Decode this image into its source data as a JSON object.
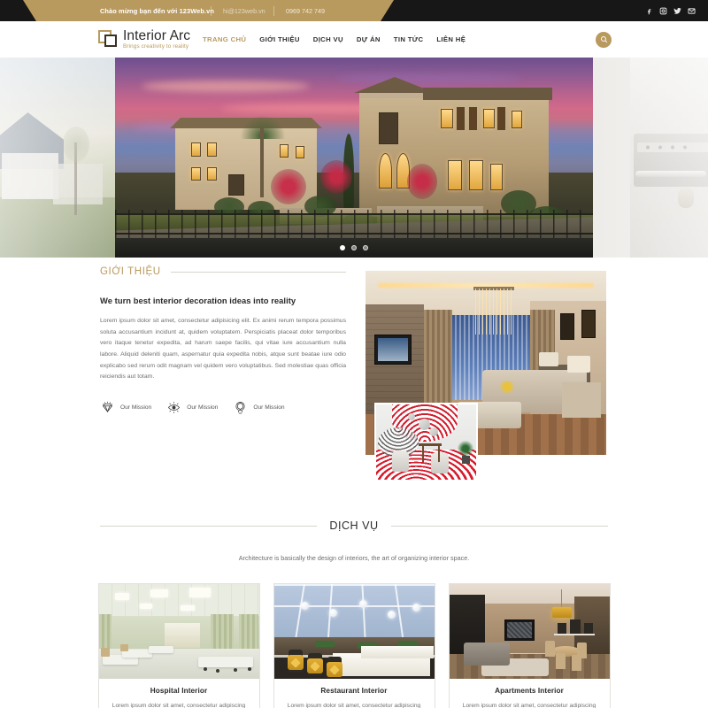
{
  "topbar": {
    "welcome": "Chào mừng bạn đến với 123Web.vn",
    "email": "hi@123web.vn",
    "phone": "0969 742 749",
    "socials": [
      {
        "name": "facebook-icon",
        "label": "Facebook"
      },
      {
        "name": "instagram-icon",
        "label": "Instagram"
      },
      {
        "name": "twitter-icon",
        "label": "Twitter"
      },
      {
        "name": "email-icon",
        "label": "Email"
      }
    ],
    "bg_color": "#171717",
    "accent_color": "#b99a5e"
  },
  "header": {
    "logo_name": "Interior Arc",
    "logo_tagline": "Brings creativity to reality",
    "nav": [
      {
        "label": "TRANG CHỦ",
        "active": true
      },
      {
        "label": "GIỚI THIỆU",
        "active": false
      },
      {
        "label": "DỊCH VỤ",
        "active": false
      },
      {
        "label": "DỰ ÁN",
        "active": false
      },
      {
        "label": "TIN TỨC",
        "active": false
      },
      {
        "label": "LIÊN HỆ",
        "active": false
      }
    ],
    "search_icon": "search-icon"
  },
  "hero": {
    "slides_count": 3,
    "active_slide": 1,
    "center_alt": "Mediterranean style houses at sunset",
    "left_alt": "Suburban house exterior",
    "right_alt": "Kitchen appliance close up"
  },
  "about": {
    "section_label": "GIỚI THIỆU",
    "heading": "We turn best interior decoration ideas into reality",
    "paragraph": "Lorem ipsum dolor sit amet, consectetur adipisicing elit. Ex animi rerum tempora possimus soluta accusantium incidunt at, quidem voluptatem. Perspiciatis placeat dolor temporibus vero itaque tenetur expedita, ad harum saepe facilis, qui vitae iure accusantium nulla labore. Aliquid deleniti quam, aspernatur quia expedita nobis, atque sunt beatae iure odio explicabo sed rerum odit magnam vel quidem vero voluptatibus. Sed molestiae quas officia reiciendis aut totam.",
    "missions": [
      {
        "icon": "diamond-icon",
        "label": "Our Mission"
      },
      {
        "icon": "eye-icon",
        "label": "Our Mission"
      },
      {
        "icon": "medal-icon",
        "label": "Our Mission"
      }
    ],
    "image_big_alt": "Modern living room with chandelier",
    "image_small_alt": "Red and white themed lounge"
  },
  "services": {
    "title": "DỊCH VỤ",
    "subtitle": "Architecture is basically the design of interiors, the art of organizing interior space.",
    "cards": [
      {
        "title": "Hospital Interior",
        "text": "Lorem ipsum dolor sit amet, consectetur adipiscing",
        "image_alt": "Hospital ward with beds"
      },
      {
        "title": "Restaurant Interior",
        "text": "Lorem ipsum dolor sit amet, consectetur adipiscing",
        "image_alt": "Banquet hall with gold chair sashes"
      },
      {
        "title": "Apartments Interior",
        "text": "Lorem ipsum dolor sit amet, consectetur adipiscing",
        "image_alt": "Modern apartment living and dining area"
      }
    ]
  }
}
